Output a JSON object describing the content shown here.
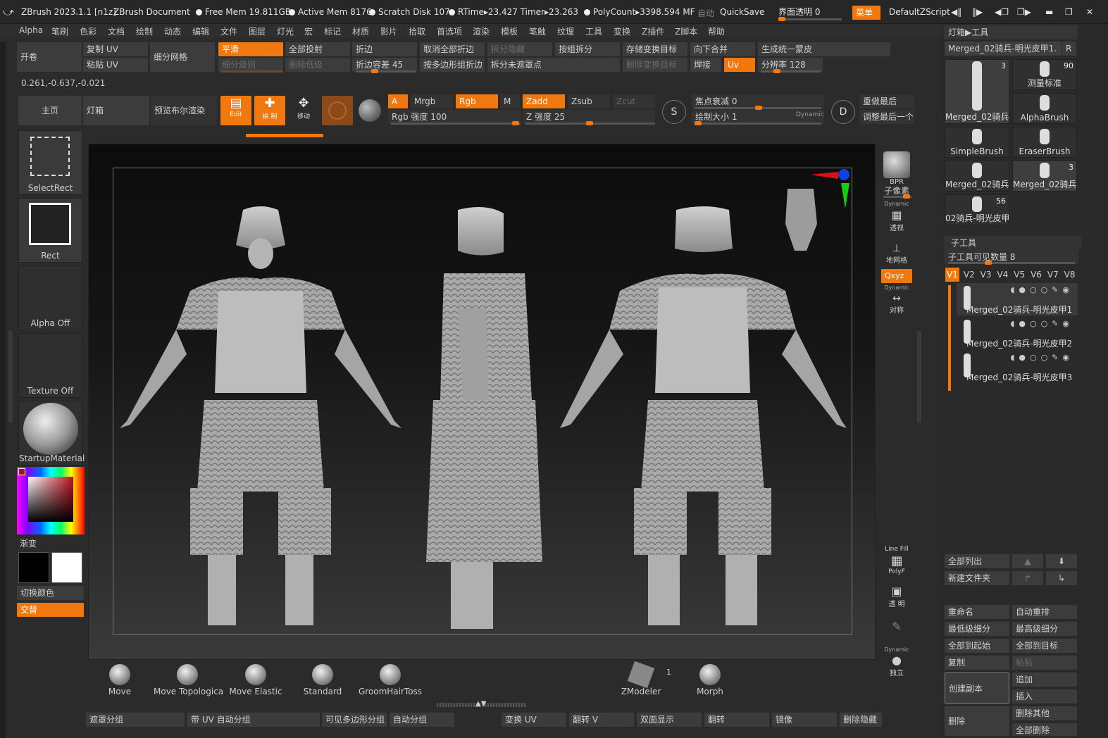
{
  "title": {
    "app": "ZBrush 2023.1.1 [n1z]",
    "doc": "ZBrush Document",
    "free_mem": "Free Mem 19.811GB",
    "active_mem": "Active Mem 8176",
    "scratch": "Scratch Disk 107",
    "rtime": "RTime▸23.427 Timer▸23.263",
    "polycount": "PolyCount▸3398.594 MF",
    "auto": "自动",
    "quicksave": "QuickSave",
    "transparency": "界面透明 0",
    "menu": "菜单",
    "script": "DefaultZScript"
  },
  "menubar": [
    "Alpha",
    "笔刷",
    "色彩",
    "文档",
    "绘制",
    "动态",
    "编辑",
    "文件",
    "图层",
    "灯光",
    "宏",
    "标记",
    "材质",
    "影片",
    "拾取",
    "首选项",
    "渲染",
    "模板",
    "笔触",
    "纹理",
    "工具",
    "变换",
    "Z插件",
    "Z脚本",
    "帮助"
  ],
  "toolbar1": {
    "kaijuan": "开卷",
    "copy_uv": "复制 UV",
    "paste_uv": "粘贴 UV",
    "subdiv_grid": "细分网格",
    "smooth": "平滑",
    "subdiv_level": "细分级别",
    "project_all": "全部投射",
    "del_lower": "删除低级",
    "crease": "折边",
    "crease_tol": "折边容差 45",
    "uncrease_all": "取消全部折边",
    "crease_pg": "按多边形组折边",
    "split_hidden": "拆分隐藏",
    "split_unmasked": "拆分未遮罩点",
    "groups_split": "按组拆分",
    "store_morph": "存储变换目标",
    "del_morph": "删除变换目标",
    "merge_down": "向下合并",
    "weld": "焊接",
    "uv": "Uv",
    "unify_skin": "生成统一蒙皮",
    "resolution": "分辨率 128"
  },
  "coords": "0.261,-0.637,-0.021",
  "toolbar2": {
    "home": "主页",
    "lightbox": "灯箱",
    "preview_bool": "预览布尔渲染",
    "edit": "Edit",
    "draw": "绘 制",
    "move": "移动",
    "a": "A",
    "mrgb": "Mrgb",
    "rgb": "Rgb",
    "m": "M",
    "zadd": "Zadd",
    "zsub": "Zsub",
    "zcut": "Zcut",
    "rgb_intensity": "Rgb 强度 100",
    "z_intensity": "Z 强度 25",
    "focal": "焦点衰减 0",
    "draw_size": "绘制大小 1",
    "dynamic": "Dynamic",
    "redo_last": "重做最后",
    "adjust_last": "调整最后一个"
  },
  "left_tiles": {
    "selectrect": "SelectRect",
    "rect": "Rect",
    "alpha": "Alpha Off",
    "texture": "Texture Off",
    "material": "StartupMaterial",
    "gradient": "渐变",
    "switch_color": "切换颜色",
    "alternate": "交替"
  },
  "colors": {
    "accent": "#f0780f",
    "bg": "#2b2b2b",
    "button": "#3c3c3c"
  },
  "right_strip": {
    "bpr": "BPR",
    "subpixel": "子像素",
    "dynamic": "Dynamic",
    "persp": "透视",
    "floor": "地网格",
    "xyz": "Qxyz",
    "sym": "对称",
    "linefill": "Line Fill",
    "polyf": "PolyF",
    "transp": "透 明",
    "solo": "独立"
  },
  "tool_panel": {
    "header": "灯箱▶工具",
    "current": "Merged_02骑兵-明光皮甲1.",
    "r": "R",
    "thumbs": [
      {
        "label": "Merged_02骑兵-",
        "count": "3"
      },
      {
        "label": "测量标准",
        "count": "90"
      },
      {
        "label": "AlphaBrush",
        "count": ""
      },
      {
        "label": "SimpleBrush",
        "count": ""
      },
      {
        "label": "EraserBrush",
        "count": ""
      },
      {
        "label": "Merged_02骑兵-",
        "count": ""
      },
      {
        "label": "Merged_02骑兵-",
        "count": "3"
      },
      {
        "label": "02骑兵-明光皮甲",
        "count": "56"
      }
    ],
    "subtool_header": "子工具",
    "visible_count": "子工具可见数量 8",
    "versions": [
      "V1",
      "V2",
      "V3",
      "V4",
      "V5",
      "V6",
      "V7",
      "V8"
    ],
    "subtools": [
      "Merged_02骑兵-明光皮甲1",
      "Merged_02骑兵-明光皮甲2",
      "Merged_02骑兵-明光皮甲3"
    ],
    "list_all": "全部列出",
    "new_folder": "新建文件夹",
    "rename": "重命名",
    "auto_reorder": "自动重排",
    "lowest": "最低级细分",
    "highest": "最高级细分",
    "all_to_start": "全部到起始",
    "all_to_target": "全部到目标",
    "copy": "复制",
    "paste": "粘贴",
    "duplicate": "创建副本",
    "append": "追加",
    "insert": "插入",
    "delete": "删除",
    "delete_other": "删除其他",
    "delete_all": "全部删除"
  },
  "brushes": [
    "Move",
    "Move Topologica",
    "Move Elastic",
    "Standard",
    "GroomHairToss"
  ],
  "zmodeler": {
    "label": "ZModeler",
    "count": "1"
  },
  "morph": "Morph",
  "bottom_bar": [
    "遮罩分组",
    "带 UV 自动分组",
    "可见多边形分组",
    "自动分组",
    "变换 UV",
    "翻转 V",
    "双面显示",
    "翻转",
    "镜像",
    "删除隐藏"
  ]
}
